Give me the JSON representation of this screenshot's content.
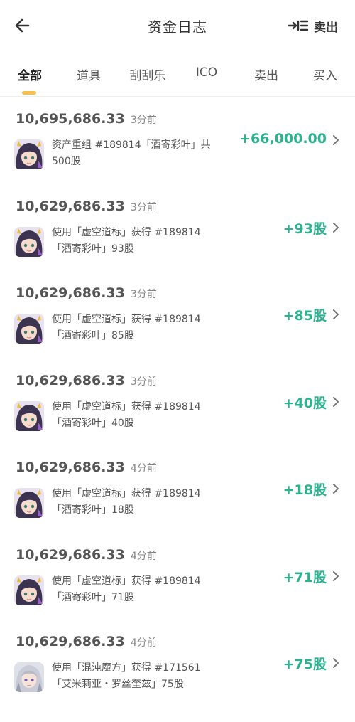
{
  "header": {
    "title": "资金日志",
    "sell_label": "卖出"
  },
  "tabs": [
    "全部",
    "道具",
    "刮刮乐",
    "ICO",
    "卖出",
    "买入"
  ],
  "active_tab": "全部",
  "colors": {
    "accent_yellow": "#f6c14b",
    "positive_green": "#2bb390",
    "text_dark": "#333333",
    "text_muted": "#888888"
  },
  "log_items": [
    {
      "balance": "10,695,686.33",
      "time": "3分前",
      "line1": "资产重组 #189814「酒寄彩叶」共",
      "line2": "500股",
      "amount": "+66,000.00",
      "avatar": "dark-hair-character-avatar"
    },
    {
      "balance": "10,629,686.33",
      "time": "3分前",
      "line1": "使用「虚空道标」获得 #189814",
      "line2": "「酒寄彩叶」93股",
      "amount": "+93股",
      "avatar": "dark-hair-character-avatar"
    },
    {
      "balance": "10,629,686.33",
      "time": "3分前",
      "line1": "使用「虚空道标」获得 #189814",
      "line2": "「酒寄彩叶」85股",
      "amount": "+85股",
      "avatar": "dark-hair-character-avatar"
    },
    {
      "balance": "10,629,686.33",
      "time": "3分前",
      "line1": "使用「虚空道标」获得 #189814",
      "line2": "「酒寄彩叶」40股",
      "amount": "+40股",
      "avatar": "dark-hair-character-avatar"
    },
    {
      "balance": "10,629,686.33",
      "time": "4分前",
      "line1": "使用「虚空道标」获得 #189814",
      "line2": "「酒寄彩叶」18股",
      "amount": "+18股",
      "avatar": "dark-hair-character-avatar"
    },
    {
      "balance": "10,629,686.33",
      "time": "4分前",
      "line1": "使用「虚空道标」获得 #189814",
      "line2": "「酒寄彩叶」71股",
      "amount": "+71股",
      "avatar": "dark-hair-character-avatar"
    },
    {
      "balance": "10,629,686.33",
      "time": "4分前",
      "line1": "使用「混沌魔方」获得 #171561",
      "line2": "「艾米莉亚・罗丝奎兹」75股",
      "amount": "+75股",
      "avatar": "silver-hair-character-avatar"
    }
  ]
}
